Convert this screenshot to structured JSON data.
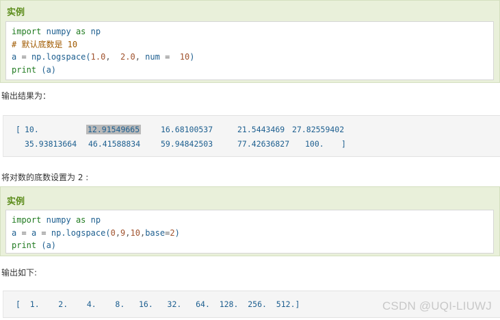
{
  "example1": {
    "title": "实例",
    "lines": {
      "l1_kw1": "import",
      "l1_mod": "numpy",
      "l1_kw2": "as",
      "l1_alias": "np",
      "l2_comment": "# 默认底数是 10",
      "l3": {
        "a": "a",
        "eq": "=",
        "call": "np.logspace(",
        "n1": "1.0",
        "c1": ",",
        "n2": "2.0",
        "c2": ",",
        "kw": "num",
        "eq2": "=",
        "n3": "10",
        "close": ")"
      },
      "l4": {
        "fn": "print",
        "arg": "(a)"
      }
    }
  },
  "para1": "输出结果为：",
  "output1": {
    "row1": [
      "[",
      "10.",
      "12.91549665",
      "16.68100537",
      "21.5443469",
      "27.82559402"
    ],
    "row2": [
      "35.93813664",
      "46.41588834",
      "59.94842503",
      "77.42636827",
      "100.",
      "]"
    ]
  },
  "para2": "将对数的底数设置为 2 :",
  "example2": {
    "title": "实例",
    "lines": {
      "l1_kw1": "import",
      "l1_mod": "numpy",
      "l1_kw2": "as",
      "l1_alias": "np",
      "l2": {
        "a1": "a",
        "eq1": "=",
        "a2": "a",
        "eq2": "=",
        "call": "np.logspace(",
        "n1": "0",
        "c1": ",",
        "n2": "9",
        "c2": ",",
        "n3": "10",
        "c3": ",",
        "kw": "base",
        "eq3": "=",
        "n4": "2",
        "close": ")"
      },
      "l3": {
        "fn": "print",
        "arg": "(a)"
      }
    }
  },
  "para3": "输出如下:",
  "output2": {
    "text": "[  1.    2.    4.    8.   16.   32.   64.  128.  256.  512.]"
  },
  "watermark": "CSDN @UQI-LIUWJ"
}
